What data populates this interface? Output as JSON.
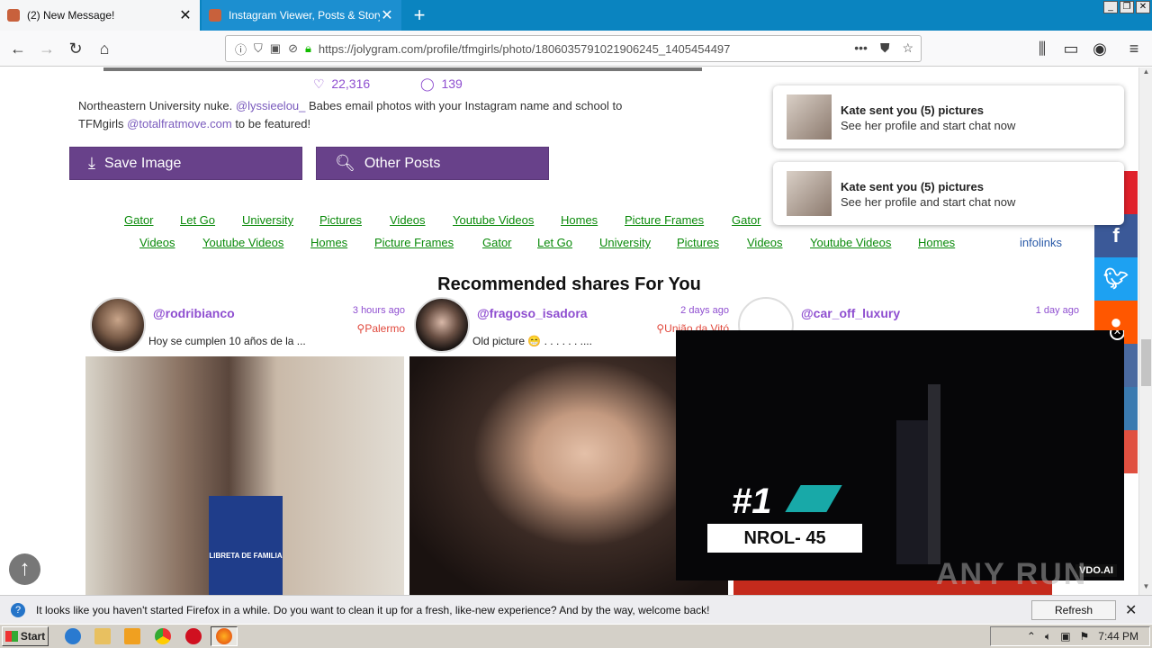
{
  "browser": {
    "tabs": [
      {
        "title": "(2) New Message!"
      },
      {
        "title": "Instagram Viewer, Posts & Story &"
      }
    ],
    "url": "https://jolygram.com/profile/tfmgirls/photo/1806035791021906245_1405454497"
  },
  "post": {
    "likes": "22,316",
    "comments": "139",
    "caption_pre": "Northeastern University nuke.",
    "caption_mention": "@lyssieelou_",
    "caption_mid": "Babes email photos with your Instagram name and school to TFMgirls",
    "caption_mention2": "@totalfratmove.com",
    "caption_post": "to be featured!",
    "save_label": "Save Image",
    "other_label": "Other Posts"
  },
  "ad_links": {
    "row1": [
      "Gator",
      "Let Go",
      "University",
      "Pictures",
      "Videos",
      "Youtube Videos",
      "Homes",
      "Picture Frames",
      "Gator"
    ],
    "row2": [
      "Videos",
      "Youtube Videos",
      "Homes",
      "Picture Frames",
      "Gator",
      "Let Go",
      "University",
      "Pictures",
      "Videos",
      "Youtube Videos",
      "Homes"
    ],
    "brand": "infolinks"
  },
  "recommended": {
    "title": "Recommended shares For You",
    "cards": [
      {
        "user": "@rodribianco",
        "time": "3 hours ago",
        "location": "Palermo",
        "desc": "Hoy se cumplen 10 años de la ..."
      },
      {
        "user": "@fragoso_isadora",
        "time": "2 days ago",
        "location": "União da Vitó",
        "desc": "Old picture 😁 . . . . . . ...."
      },
      {
        "user": "@car_off_luxury",
        "time": "1 day ago",
        "location": "",
        "desc": ""
      }
    ]
  },
  "notifications": [
    {
      "title": "Kate sent you (5) pictures",
      "subtitle": "See her profile and start chat now"
    },
    {
      "title": "Kate sent you (5) pictures",
      "subtitle": "See her profile and start chat now"
    }
  ],
  "video": {
    "rank": "#1",
    "label": "NROL- 45",
    "brand": "VDO.AI"
  },
  "watermark": "ANY RUN",
  "firefox_bar": {
    "message": "It looks like you haven't started Firefox in a while. Do you want to clean it up for a fresh, like-new experience? And by the way, welcome back!",
    "button": "Refresh Firefox…"
  },
  "taskbar": {
    "start": "Start",
    "clock": "7:44 PM"
  },
  "colors": {
    "accent_purple": "#68418a",
    "link_green": "#0a8a0a",
    "tab_blue": "#0a84c0"
  }
}
